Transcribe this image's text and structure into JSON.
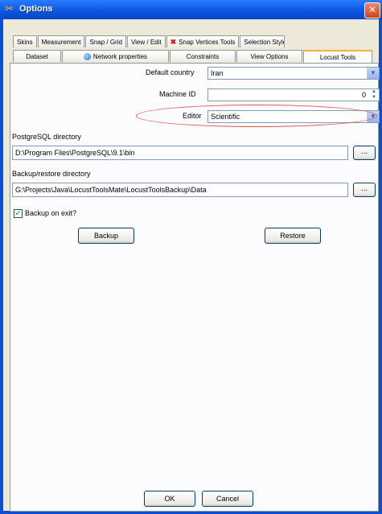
{
  "window": {
    "title": "Options",
    "close_glyph": "✕",
    "title_icon": "tools-icon"
  },
  "tabs": {
    "row1": [
      {
        "label": "Skins"
      },
      {
        "label": "Measurement"
      },
      {
        "label": "Snap / Grid"
      },
      {
        "label": "View / Edit"
      },
      {
        "label": "Snap Vertices Tools"
      },
      {
        "label": "Selection Style"
      }
    ],
    "row2": [
      {
        "label": "Dataset"
      },
      {
        "label": "Network properties"
      },
      {
        "label": "Constraints"
      },
      {
        "label": "View Options"
      },
      {
        "label": "Locust Tools",
        "active": true
      }
    ]
  },
  "form": {
    "default_country_label": "Default country",
    "default_country_value": "Iran",
    "machine_id_label": "Machine ID",
    "machine_id_value": "0",
    "editor_label": "Editor",
    "editor_value": "Scientific",
    "postgres_label": "PostgreSQL directory",
    "postgres_value": "D:\\Program Files\\PostgreSQL\\9.1\\bin",
    "backup_dir_label": "Backup/restore directory",
    "backup_dir_value": "G:\\Projects\\Java\\LocustToolsMate\\LocustToolsBackup\\Data",
    "browse_label": "...",
    "backup_on_exit_label": "Backup on exit?",
    "backup_on_exit_checked": true,
    "backup_button": "Backup",
    "restore_button": "Restore"
  },
  "footer": {
    "ok": "OK",
    "cancel": "Cancel"
  },
  "colors": {
    "titlebar": "#0a55e0",
    "accent_tab": "#f7b13a",
    "highlight_ellipse": "#e0554d",
    "panel_bg": "#ece9d8"
  }
}
